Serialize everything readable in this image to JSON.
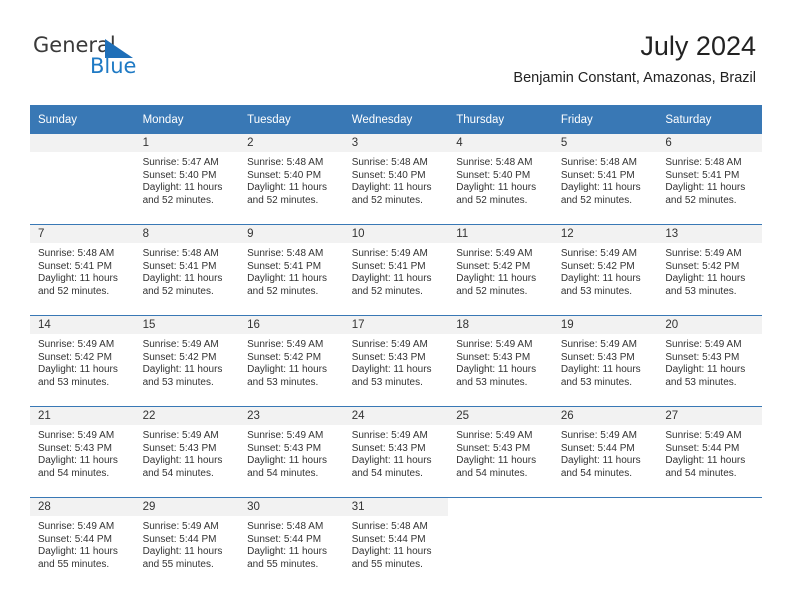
{
  "brand": {
    "name_part1": "General",
    "name_part2": "Blue",
    "accent_color": "#1f7ac4",
    "triangle_color": "#1f6fb8"
  },
  "header": {
    "title": "July 2024",
    "subtitle": "Benjamin Constant, Amazonas, Brazil",
    "header_bg": "#3978b5"
  },
  "weekday_headers": [
    "Sunday",
    "Monday",
    "Tuesday",
    "Wednesday",
    "Thursday",
    "Friday",
    "Saturday"
  ],
  "weeks": [
    [
      {
        "day": "",
        "sunrise": "",
        "sunset": "",
        "daylight_l1": "",
        "daylight_l2": "",
        "empty": true
      },
      {
        "day": "1",
        "sunrise": "Sunrise: 5:47 AM",
        "sunset": "Sunset: 5:40 PM",
        "daylight_l1": "Daylight: 11 hours",
        "daylight_l2": "and 52 minutes."
      },
      {
        "day": "2",
        "sunrise": "Sunrise: 5:48 AM",
        "sunset": "Sunset: 5:40 PM",
        "daylight_l1": "Daylight: 11 hours",
        "daylight_l2": "and 52 minutes."
      },
      {
        "day": "3",
        "sunrise": "Sunrise: 5:48 AM",
        "sunset": "Sunset: 5:40 PM",
        "daylight_l1": "Daylight: 11 hours",
        "daylight_l2": "and 52 minutes."
      },
      {
        "day": "4",
        "sunrise": "Sunrise: 5:48 AM",
        "sunset": "Sunset: 5:40 PM",
        "daylight_l1": "Daylight: 11 hours",
        "daylight_l2": "and 52 minutes."
      },
      {
        "day": "5",
        "sunrise": "Sunrise: 5:48 AM",
        "sunset": "Sunset: 5:41 PM",
        "daylight_l1": "Daylight: 11 hours",
        "daylight_l2": "and 52 minutes."
      },
      {
        "day": "6",
        "sunrise": "Sunrise: 5:48 AM",
        "sunset": "Sunset: 5:41 PM",
        "daylight_l1": "Daylight: 11 hours",
        "daylight_l2": "and 52 minutes."
      }
    ],
    [
      {
        "day": "7",
        "sunrise": "Sunrise: 5:48 AM",
        "sunset": "Sunset: 5:41 PM",
        "daylight_l1": "Daylight: 11 hours",
        "daylight_l2": "and 52 minutes."
      },
      {
        "day": "8",
        "sunrise": "Sunrise: 5:48 AM",
        "sunset": "Sunset: 5:41 PM",
        "daylight_l1": "Daylight: 11 hours",
        "daylight_l2": "and 52 minutes."
      },
      {
        "day": "9",
        "sunrise": "Sunrise: 5:48 AM",
        "sunset": "Sunset: 5:41 PM",
        "daylight_l1": "Daylight: 11 hours",
        "daylight_l2": "and 52 minutes."
      },
      {
        "day": "10",
        "sunrise": "Sunrise: 5:49 AM",
        "sunset": "Sunset: 5:41 PM",
        "daylight_l1": "Daylight: 11 hours",
        "daylight_l2": "and 52 minutes."
      },
      {
        "day": "11",
        "sunrise": "Sunrise: 5:49 AM",
        "sunset": "Sunset: 5:42 PM",
        "daylight_l1": "Daylight: 11 hours",
        "daylight_l2": "and 52 minutes."
      },
      {
        "day": "12",
        "sunrise": "Sunrise: 5:49 AM",
        "sunset": "Sunset: 5:42 PM",
        "daylight_l1": "Daylight: 11 hours",
        "daylight_l2": "and 53 minutes."
      },
      {
        "day": "13",
        "sunrise": "Sunrise: 5:49 AM",
        "sunset": "Sunset: 5:42 PM",
        "daylight_l1": "Daylight: 11 hours",
        "daylight_l2": "and 53 minutes."
      }
    ],
    [
      {
        "day": "14",
        "sunrise": "Sunrise: 5:49 AM",
        "sunset": "Sunset: 5:42 PM",
        "daylight_l1": "Daylight: 11 hours",
        "daylight_l2": "and 53 minutes."
      },
      {
        "day": "15",
        "sunrise": "Sunrise: 5:49 AM",
        "sunset": "Sunset: 5:42 PM",
        "daylight_l1": "Daylight: 11 hours",
        "daylight_l2": "and 53 minutes."
      },
      {
        "day": "16",
        "sunrise": "Sunrise: 5:49 AM",
        "sunset": "Sunset: 5:42 PM",
        "daylight_l1": "Daylight: 11 hours",
        "daylight_l2": "and 53 minutes."
      },
      {
        "day": "17",
        "sunrise": "Sunrise: 5:49 AM",
        "sunset": "Sunset: 5:43 PM",
        "daylight_l1": "Daylight: 11 hours",
        "daylight_l2": "and 53 minutes."
      },
      {
        "day": "18",
        "sunrise": "Sunrise: 5:49 AM",
        "sunset": "Sunset: 5:43 PM",
        "daylight_l1": "Daylight: 11 hours",
        "daylight_l2": "and 53 minutes."
      },
      {
        "day": "19",
        "sunrise": "Sunrise: 5:49 AM",
        "sunset": "Sunset: 5:43 PM",
        "daylight_l1": "Daylight: 11 hours",
        "daylight_l2": "and 53 minutes."
      },
      {
        "day": "20",
        "sunrise": "Sunrise: 5:49 AM",
        "sunset": "Sunset: 5:43 PM",
        "daylight_l1": "Daylight: 11 hours",
        "daylight_l2": "and 53 minutes."
      }
    ],
    [
      {
        "day": "21",
        "sunrise": "Sunrise: 5:49 AM",
        "sunset": "Sunset: 5:43 PM",
        "daylight_l1": "Daylight: 11 hours",
        "daylight_l2": "and 54 minutes."
      },
      {
        "day": "22",
        "sunrise": "Sunrise: 5:49 AM",
        "sunset": "Sunset: 5:43 PM",
        "daylight_l1": "Daylight: 11 hours",
        "daylight_l2": "and 54 minutes."
      },
      {
        "day": "23",
        "sunrise": "Sunrise: 5:49 AM",
        "sunset": "Sunset: 5:43 PM",
        "daylight_l1": "Daylight: 11 hours",
        "daylight_l2": "and 54 minutes."
      },
      {
        "day": "24",
        "sunrise": "Sunrise: 5:49 AM",
        "sunset": "Sunset: 5:43 PM",
        "daylight_l1": "Daylight: 11 hours",
        "daylight_l2": "and 54 minutes."
      },
      {
        "day": "25",
        "sunrise": "Sunrise: 5:49 AM",
        "sunset": "Sunset: 5:43 PM",
        "daylight_l1": "Daylight: 11 hours",
        "daylight_l2": "and 54 minutes."
      },
      {
        "day": "26",
        "sunrise": "Sunrise: 5:49 AM",
        "sunset": "Sunset: 5:44 PM",
        "daylight_l1": "Daylight: 11 hours",
        "daylight_l2": "and 54 minutes."
      },
      {
        "day": "27",
        "sunrise": "Sunrise: 5:49 AM",
        "sunset": "Sunset: 5:44 PM",
        "daylight_l1": "Daylight: 11 hours",
        "daylight_l2": "and 54 minutes."
      }
    ],
    [
      {
        "day": "28",
        "sunrise": "Sunrise: 5:49 AM",
        "sunset": "Sunset: 5:44 PM",
        "daylight_l1": "Daylight: 11 hours",
        "daylight_l2": "and 55 minutes."
      },
      {
        "day": "29",
        "sunrise": "Sunrise: 5:49 AM",
        "sunset": "Sunset: 5:44 PM",
        "daylight_l1": "Daylight: 11 hours",
        "daylight_l2": "and 55 minutes."
      },
      {
        "day": "30",
        "sunrise": "Sunrise: 5:48 AM",
        "sunset": "Sunset: 5:44 PM",
        "daylight_l1": "Daylight: 11 hours",
        "daylight_l2": "and 55 minutes."
      },
      {
        "day": "31",
        "sunrise": "Sunrise: 5:48 AM",
        "sunset": "Sunset: 5:44 PM",
        "daylight_l1": "Daylight: 11 hours",
        "daylight_l2": "and 55 minutes."
      },
      {
        "day": "",
        "sunrise": "",
        "sunset": "",
        "daylight_l1": "",
        "daylight_l2": "",
        "blank": true
      },
      {
        "day": "",
        "sunrise": "",
        "sunset": "",
        "daylight_l1": "",
        "daylight_l2": "",
        "blank": true
      },
      {
        "day": "",
        "sunrise": "",
        "sunset": "",
        "daylight_l1": "",
        "daylight_l2": "",
        "blank": true
      }
    ]
  ]
}
